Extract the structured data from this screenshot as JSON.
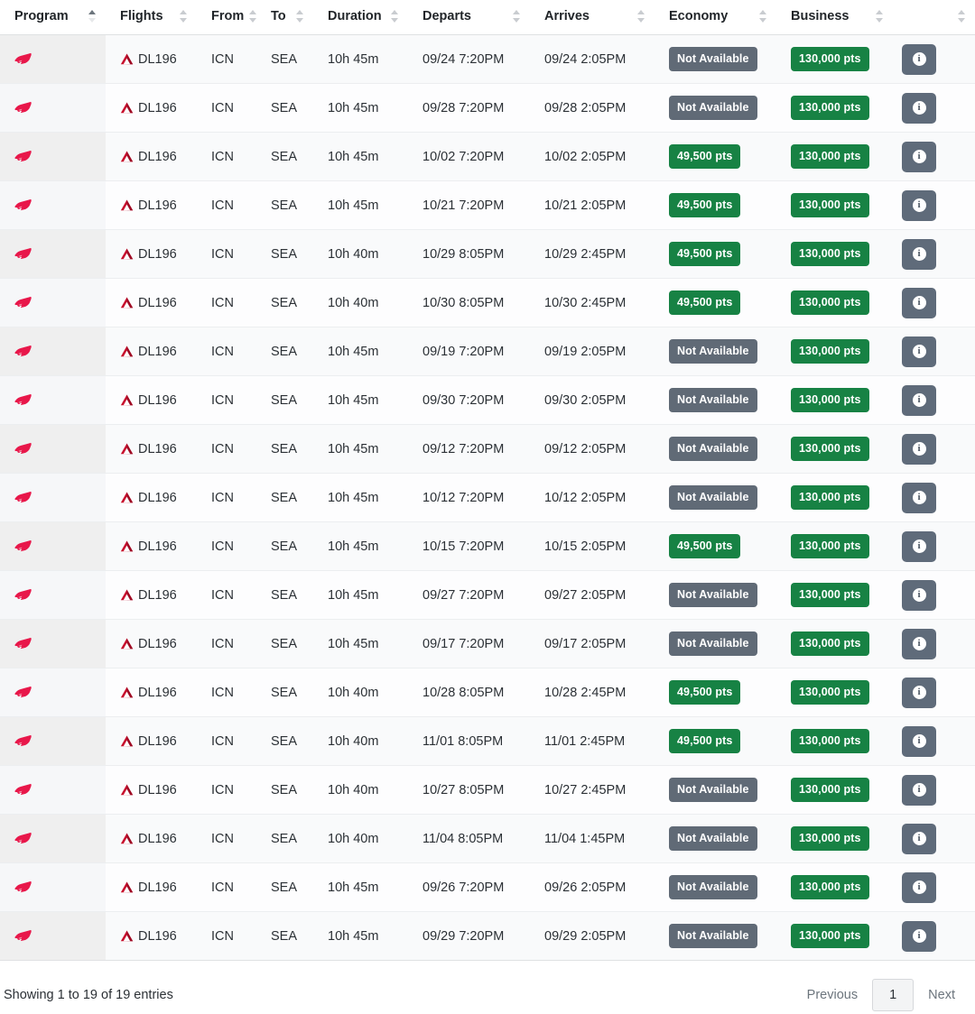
{
  "table": {
    "columns": [
      {
        "key": "program",
        "label": "Program",
        "sortable": true,
        "sorted": "asc"
      },
      {
        "key": "flights",
        "label": "Flights",
        "sortable": true,
        "sorted": "none"
      },
      {
        "key": "from",
        "label": "From",
        "sortable": true,
        "sorted": "none"
      },
      {
        "key": "to",
        "label": "To",
        "sortable": true,
        "sorted": "none"
      },
      {
        "key": "duration",
        "label": "Duration",
        "sortable": true,
        "sorted": "none"
      },
      {
        "key": "departs",
        "label": "Departs",
        "sortable": true,
        "sorted": "none"
      },
      {
        "key": "arrives",
        "label": "Arrives",
        "sortable": true,
        "sorted": "none"
      },
      {
        "key": "economy",
        "label": "Economy",
        "sortable": true,
        "sorted": "none"
      },
      {
        "key": "business",
        "label": "Business",
        "sortable": true,
        "sorted": "none"
      },
      {
        "key": "info",
        "label": "",
        "sortable": true,
        "sorted": "none"
      }
    ],
    "program_icon": "qantas-logo-icon",
    "airline_icon": "delta-airlines-icon",
    "info_icon": "info-icon",
    "rows": [
      {
        "program": "",
        "flight": "DL196",
        "from": "ICN",
        "to": "SEA",
        "duration": "10h 45m",
        "departs": "09/24 7:20PM",
        "arrives": "09/24 2:05PM",
        "economy": "Not Available",
        "economy_state": "unavailable",
        "business": "130,000 pts",
        "business_state": "available"
      },
      {
        "program": "",
        "flight": "DL196",
        "from": "ICN",
        "to": "SEA",
        "duration": "10h 45m",
        "departs": "09/28 7:20PM",
        "arrives": "09/28 2:05PM",
        "economy": "Not Available",
        "economy_state": "unavailable",
        "business": "130,000 pts",
        "business_state": "available"
      },
      {
        "program": "",
        "flight": "DL196",
        "from": "ICN",
        "to": "SEA",
        "duration": "10h 45m",
        "departs": "10/02 7:20PM",
        "arrives": "10/02 2:05PM",
        "economy": "49,500 pts",
        "economy_state": "available",
        "business": "130,000 pts",
        "business_state": "available"
      },
      {
        "program": "",
        "flight": "DL196",
        "from": "ICN",
        "to": "SEA",
        "duration": "10h 45m",
        "departs": "10/21 7:20PM",
        "arrives": "10/21 2:05PM",
        "economy": "49,500 pts",
        "economy_state": "available",
        "business": "130,000 pts",
        "business_state": "available"
      },
      {
        "program": "",
        "flight": "DL196",
        "from": "ICN",
        "to": "SEA",
        "duration": "10h 40m",
        "departs": "10/29 8:05PM",
        "arrives": "10/29 2:45PM",
        "economy": "49,500 pts",
        "economy_state": "available",
        "business": "130,000 pts",
        "business_state": "available"
      },
      {
        "program": "",
        "flight": "DL196",
        "from": "ICN",
        "to": "SEA",
        "duration": "10h 40m",
        "departs": "10/30 8:05PM",
        "arrives": "10/30 2:45PM",
        "economy": "49,500 pts",
        "economy_state": "available",
        "business": "130,000 pts",
        "business_state": "available"
      },
      {
        "program": "",
        "flight": "DL196",
        "from": "ICN",
        "to": "SEA",
        "duration": "10h 45m",
        "departs": "09/19 7:20PM",
        "arrives": "09/19 2:05PM",
        "economy": "Not Available",
        "economy_state": "unavailable",
        "business": "130,000 pts",
        "business_state": "available"
      },
      {
        "program": "",
        "flight": "DL196",
        "from": "ICN",
        "to": "SEA",
        "duration": "10h 45m",
        "departs": "09/30 7:20PM",
        "arrives": "09/30 2:05PM",
        "economy": "Not Available",
        "economy_state": "unavailable",
        "business": "130,000 pts",
        "business_state": "available"
      },
      {
        "program": "",
        "flight": "DL196",
        "from": "ICN",
        "to": "SEA",
        "duration": "10h 45m",
        "departs": "09/12 7:20PM",
        "arrives": "09/12 2:05PM",
        "economy": "Not Available",
        "economy_state": "unavailable",
        "business": "130,000 pts",
        "business_state": "available"
      },
      {
        "program": "",
        "flight": "DL196",
        "from": "ICN",
        "to": "SEA",
        "duration": "10h 45m",
        "departs": "10/12 7:20PM",
        "arrives": "10/12 2:05PM",
        "economy": "Not Available",
        "economy_state": "unavailable",
        "business": "130,000 pts",
        "business_state": "available"
      },
      {
        "program": "",
        "flight": "DL196",
        "from": "ICN",
        "to": "SEA",
        "duration": "10h 45m",
        "departs": "10/15 7:20PM",
        "arrives": "10/15 2:05PM",
        "economy": "49,500 pts",
        "economy_state": "available",
        "business": "130,000 pts",
        "business_state": "available"
      },
      {
        "program": "",
        "flight": "DL196",
        "from": "ICN",
        "to": "SEA",
        "duration": "10h 45m",
        "departs": "09/27 7:20PM",
        "arrives": "09/27 2:05PM",
        "economy": "Not Available",
        "economy_state": "unavailable",
        "business": "130,000 pts",
        "business_state": "available"
      },
      {
        "program": "",
        "flight": "DL196",
        "from": "ICN",
        "to": "SEA",
        "duration": "10h 45m",
        "departs": "09/17 7:20PM",
        "arrives": "09/17 2:05PM",
        "economy": "Not Available",
        "economy_state": "unavailable",
        "business": "130,000 pts",
        "business_state": "available"
      },
      {
        "program": "",
        "flight": "DL196",
        "from": "ICN",
        "to": "SEA",
        "duration": "10h 40m",
        "departs": "10/28 8:05PM",
        "arrives": "10/28 2:45PM",
        "economy": "49,500 pts",
        "economy_state": "available",
        "business": "130,000 pts",
        "business_state": "available"
      },
      {
        "program": "",
        "flight": "DL196",
        "from": "ICN",
        "to": "SEA",
        "duration": "10h 40m",
        "departs": "11/01 8:05PM",
        "arrives": "11/01 2:45PM",
        "economy": "49,500 pts",
        "economy_state": "available",
        "business": "130,000 pts",
        "business_state": "available"
      },
      {
        "program": "",
        "flight": "DL196",
        "from": "ICN",
        "to": "SEA",
        "duration": "10h 40m",
        "departs": "10/27 8:05PM",
        "arrives": "10/27 2:45PM",
        "economy": "Not Available",
        "economy_state": "unavailable",
        "business": "130,000 pts",
        "business_state": "available"
      },
      {
        "program": "",
        "flight": "DL196",
        "from": "ICN",
        "to": "SEA",
        "duration": "10h 40m",
        "departs": "11/04 8:05PM",
        "arrives": "11/04 1:45PM",
        "economy": "Not Available",
        "economy_state": "unavailable",
        "business": "130,000 pts",
        "business_state": "available"
      },
      {
        "program": "",
        "flight": "DL196",
        "from": "ICN",
        "to": "SEA",
        "duration": "10h 45m",
        "departs": "09/26 7:20PM",
        "arrives": "09/26 2:05PM",
        "economy": "Not Available",
        "economy_state": "unavailable",
        "business": "130,000 pts",
        "business_state": "available"
      },
      {
        "program": "",
        "flight": "DL196",
        "from": "ICN",
        "to": "SEA",
        "duration": "10h 45m",
        "departs": "09/29 7:20PM",
        "arrives": "09/29 2:05PM",
        "economy": "Not Available",
        "economy_state": "unavailable",
        "business": "130,000 pts",
        "business_state": "available"
      }
    ]
  },
  "footer": {
    "showing_text": "Showing 1 to 19 of 19 entries",
    "previous_label": "Previous",
    "next_label": "Next",
    "current_page": "1"
  },
  "colors": {
    "badge_available": "#178244",
    "badge_unavailable": "#606a76",
    "info_button": "#5f6b7a",
    "program_logo": "#e8174a",
    "airline_logo": "#c8102e",
    "row_stripe": "#f9fafb",
    "sorted_column": "#efefef"
  }
}
